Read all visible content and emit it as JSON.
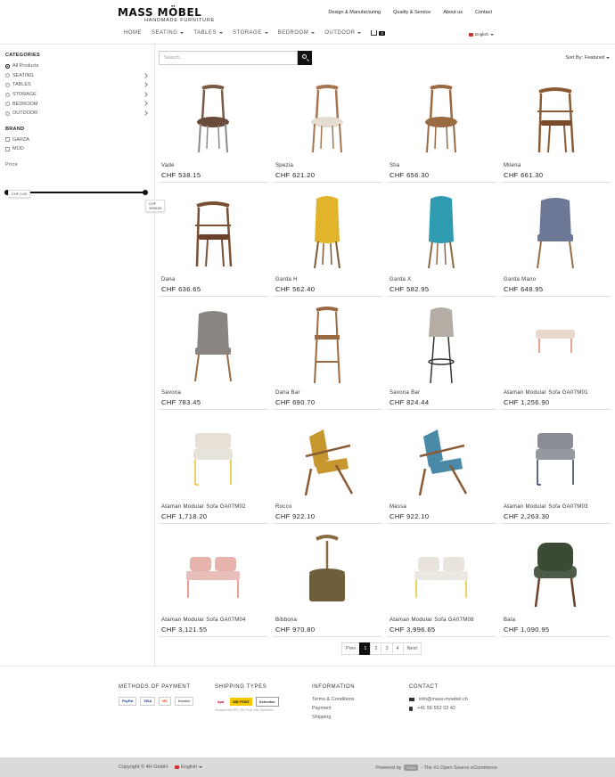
{
  "brand": {
    "name": "MASS MÖBEL",
    "tagline": "HANDMADE FURNITURE"
  },
  "toplinks": [
    "Design & Manufacturing",
    "Quality & Service",
    "About us",
    "Contact"
  ],
  "nav": {
    "items": [
      {
        "label": "HOME",
        "dropdown": false
      },
      {
        "label": "SEATING",
        "dropdown": true
      },
      {
        "label": "TABLES",
        "dropdown": true
      },
      {
        "label": "STORAGE",
        "dropdown": true
      },
      {
        "label": "BEDROOM",
        "dropdown": true
      },
      {
        "label": "OUTDOOR",
        "dropdown": true
      }
    ],
    "cart_count": "0",
    "language": "English"
  },
  "sidebar": {
    "categories_title": "CATEGORIES",
    "categories": [
      {
        "label": "All Products",
        "selected": true,
        "has_children": false
      },
      {
        "label": "SEATING",
        "selected": false,
        "has_children": true
      },
      {
        "label": "TABLES",
        "selected": false,
        "has_children": true
      },
      {
        "label": "STORAGE",
        "selected": false,
        "has_children": true
      },
      {
        "label": "BEDROOM",
        "selected": false,
        "has_children": true
      },
      {
        "label": "OUTDOOR",
        "selected": false,
        "has_children": true
      }
    ],
    "brand_title": "BRAND",
    "brands": [
      "GARZA",
      "MOD"
    ],
    "price_title": "Price",
    "price_min": "CHF 0.00",
    "price_max": "CHF 3996.65"
  },
  "search": {
    "placeholder": "Search..."
  },
  "sort": {
    "label": "Sort By:",
    "value": "Featured"
  },
  "products": [
    {
      "name": "Vade",
      "price": "CHF 538.15",
      "kind": "chair",
      "color": "#7a5a45",
      "seat": "#6a4a38",
      "legs": "#8a8a8a"
    },
    {
      "name": "Spezia",
      "price": "CHF 621.20",
      "kind": "chair",
      "color": "#a87551",
      "seat": "#e4dcd0",
      "legs": "#a87551"
    },
    {
      "name": "Stia",
      "price": "CHF 656.30",
      "kind": "chair",
      "color": "#9a6a42",
      "seat": "#9a6a42",
      "legs": "#9a6a42"
    },
    {
      "name": "Milena",
      "price": "CHF 661.30",
      "kind": "armchair-wood",
      "color": "#8a5a35",
      "seat": "#7a4a2a",
      "legs": "#8a5a35"
    },
    {
      "name": "Dana",
      "price": "CHF 636.65",
      "kind": "armchair-wood",
      "color": "#7a4f32",
      "seat": "#6a4028",
      "legs": "#7a4f32"
    },
    {
      "name": "Garda H",
      "price": "CHF 562.40",
      "kind": "shell",
      "color": "#e2b42c",
      "seat": "#e2b42c",
      "legs": "#7a5a3a"
    },
    {
      "name": "Garda X",
      "price": "CHF 582.95",
      "kind": "shell",
      "color": "#2f9bb0",
      "seat": "#2f9bb0",
      "legs": "#8a6a45"
    },
    {
      "name": "Garda Mano",
      "price": "CHF 648.95",
      "kind": "armchair-fabric",
      "color": "#6c7896",
      "seat": "#6c7896",
      "legs": "#9a6a42"
    },
    {
      "name": "Savona",
      "price": "CHF 783.45",
      "kind": "armchair-fabric",
      "color": "#8a8580",
      "seat": "#8a8580",
      "legs": "#9a6a42"
    },
    {
      "name": "Dana Bar",
      "price": "CHF 690.70",
      "kind": "bar",
      "color": "#9a6a42",
      "seat": "#9a6a42",
      "legs": "#9a6a42"
    },
    {
      "name": "Savona Bar",
      "price": "CHF 824.44",
      "kind": "bar-fabric",
      "color": "#b5aca4",
      "seat": "#b5aca4",
      "legs": "#333333"
    },
    {
      "name": "Ataman Modular Sofa GA07M01",
      "price": "CHF 1,256.90",
      "kind": "ottoman",
      "color": "#e8d9cc",
      "seat": "#e8d9cc",
      "legs": "#e0826a"
    },
    {
      "name": "Ataman Modular Sofa GA07M02",
      "price": "CHF 1,718.20",
      "kind": "sofa-1",
      "color": "#e6e0d6",
      "seat": "#e6e0d6",
      "legs": "#e6c530"
    },
    {
      "name": "Rocco",
      "price": "CHF 922.10",
      "kind": "lounge",
      "color": "#c6962f",
      "seat": "#c6962f",
      "legs": "#8a5a35"
    },
    {
      "name": "Massa",
      "price": "CHF 922.10",
      "kind": "lounge",
      "color": "#4a89a8",
      "seat": "#4a89a8",
      "legs": "#8a5a35"
    },
    {
      "name": "Ataman Modular Sofa GA07M03",
      "price": "CHF 2,263.30",
      "kind": "sofa-1",
      "color": "#8a8d95",
      "seat": "#8a8d95",
      "legs": "#2a3a5a"
    },
    {
      "name": "Ataman Modular Sofa GA07M04",
      "price": "CHF 3,121.55",
      "kind": "sofa-2",
      "color": "#e6b3ac",
      "seat": "#e6b3ac",
      "legs": "#e0826a"
    },
    {
      "name": "Bibbona",
      "price": "CHF 970.80",
      "kind": "stool-round",
      "color": "#8a6a40",
      "seat": "#6e5f3a",
      "legs": "#8a5a35"
    },
    {
      "name": "Ataman Modular Sofa GA07M08",
      "price": "CHF 3,996.65",
      "kind": "sofa-2",
      "color": "#e8e4dc",
      "seat": "#e8e4dc",
      "legs": "#e6c530"
    },
    {
      "name": "Bala",
      "price": "CHF 1,090.95",
      "kind": "club",
      "color": "#3a4a35",
      "seat": "#3a4a35",
      "legs": "#6a4028"
    }
  ],
  "pagination": {
    "prev": "Prev",
    "pages": [
      "1",
      "2",
      "3",
      "4"
    ],
    "active": "1",
    "next": "Next"
  },
  "footer": {
    "payment_title": "METHODS OF PAYMENT",
    "payments": [
      "PayPal",
      "VISA",
      "MC",
      "Invoice"
    ],
    "shipping_title": "SHIPPING TYPES",
    "shipping": [
      "dpd",
      "DIE POST",
      "Schenker"
    ],
    "shipping_note": "Versand mit DPD, Die Post oder Spedition",
    "info_title": "INFORMATION",
    "info_links": [
      "Terms & Conditions",
      "Payment",
      "Shipping"
    ],
    "contact_title": "CONTACT",
    "email": "info@mass-moebel.ch",
    "phone": "+41 56 552 02 42",
    "copyright": "Copyright © 4H GmbH",
    "footer_language": "English",
    "powered_prefix": "Powered by",
    "powered_logo": "Odoo",
    "powered_suffix": "- The #1 Open Source eCommerce"
  }
}
